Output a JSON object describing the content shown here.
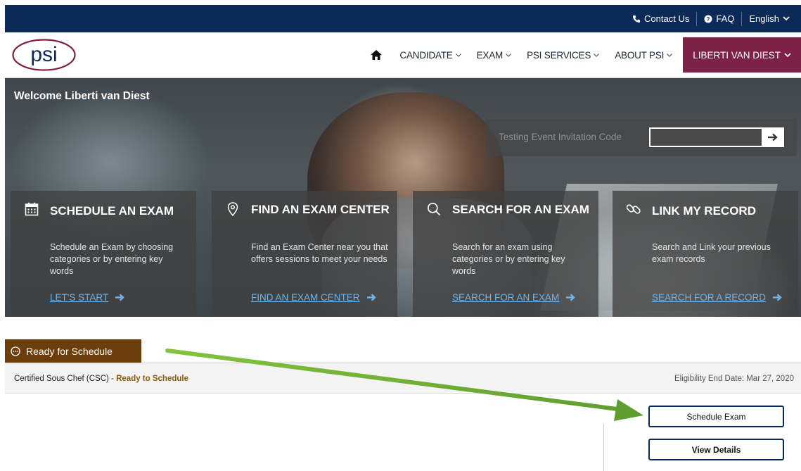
{
  "topbar": {
    "contact": "Contact Us",
    "faq": "FAQ",
    "language": "English"
  },
  "nav": {
    "logo_text": "psi",
    "items": [
      {
        "label": "CANDIDATE"
      },
      {
        "label": "EXAM"
      },
      {
        "label": "PSI SERVICES"
      },
      {
        "label": "ABOUT PSI"
      }
    ],
    "user": "LIBERTI VAN DIEST"
  },
  "hero": {
    "welcome": "Welcome Liberti van Diest",
    "invite_label": "Testing Event Invitation Code",
    "invite_value": "",
    "cards": [
      {
        "icon": "calendar-icon",
        "title": "SCHEDULE AN EXAM",
        "desc": "Schedule an Exam by choosing categories or by entering key words",
        "cta": "LET'S START"
      },
      {
        "icon": "location-pin-icon",
        "title": "FIND AN EXAM CENTER",
        "desc": "Find an Exam Center near you that offers sessions to meet your needs",
        "cta": "FIND AN EXAM CENTER"
      },
      {
        "icon": "search-icon",
        "title": "SEARCH FOR AN EXAM",
        "desc": "Search for an exam using categories or by entering key words",
        "cta": "SEARCH FOR AN EXAM"
      },
      {
        "icon": "link-icon",
        "title": "LINK MY RECORD",
        "desc": "Search and Link your previous exam records",
        "cta": "SEARCH FOR A RECORD"
      }
    ]
  },
  "ready": {
    "tab_label": "Ready for Schedule",
    "exam_name": "Certified Sous Chef (CSC)",
    "exam_sep": " - ",
    "status": "Ready to Schedule",
    "eligibility": "Eligibility End Date: Mar 27, 2020",
    "schedule_button": "Schedule Exam",
    "details_button": "View Details"
  },
  "colors": {
    "topbar": "#0b2a57",
    "user_button": "#7e2146",
    "tab": "#6b3e0b",
    "link": "#6fb3e8",
    "annotation_arrow": "#6aa933"
  }
}
